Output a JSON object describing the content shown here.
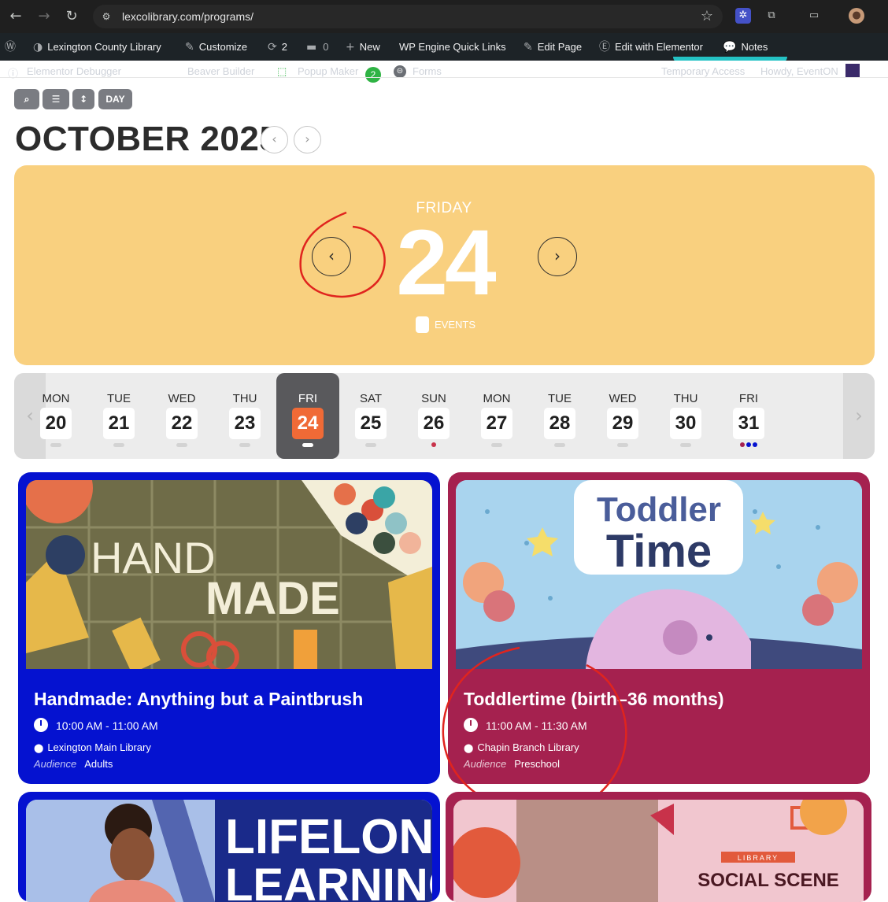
{
  "browser": {
    "url": "lexcolibrary.com/programs/",
    "back_icon": "←",
    "forward_icon": "→",
    "reload_icon": "↻",
    "star_icon": "☆"
  },
  "adminbar": {
    "site_name": "Lexington County Library",
    "customize": "Customize",
    "updates_count": "2",
    "comments_count": "0",
    "new": "New",
    "wp_engine": "WP Engine Quick Links",
    "edit_page": "Edit Page",
    "edit_elementor": "Edit with Elementor",
    "notes": "Notes"
  },
  "subbar": {
    "debugger": "Elementor Debugger",
    "beaver": "Beaver Builder",
    "popup": "Popup Maker",
    "popup_count": "2",
    "forms": "Forms",
    "temp_access": "Temporary Access",
    "howdy": "Howdy, EventON"
  },
  "controls": {
    "search_icon": "⌕",
    "filter_icon": "☰",
    "sort_icon": "↕",
    "day_label": "DAY"
  },
  "calendar": {
    "month_title": "OCTOBER 2025",
    "prev_icon": "‹",
    "next_icon": "›",
    "day_name": "FRIDAY",
    "day_number": "24",
    "events_label": "EVENTS",
    "accent_color": "#f9d07f",
    "active_color": "#f06a36"
  },
  "strip": {
    "days": [
      {
        "name": "MON",
        "num": "20"
      },
      {
        "name": "TUE",
        "num": "21"
      },
      {
        "name": "WED",
        "num": "22"
      },
      {
        "name": "THU",
        "num": "23"
      },
      {
        "name": "FRI",
        "num": "24"
      },
      {
        "name": "SAT",
        "num": "25"
      },
      {
        "name": "SUN",
        "num": "26"
      },
      {
        "name": "MON",
        "num": "27"
      },
      {
        "name": "TUE",
        "num": "28"
      },
      {
        "name": "WED",
        "num": "29"
      },
      {
        "name": "THU",
        "num": "30"
      },
      {
        "name": "FRI",
        "num": "31"
      }
    ],
    "active_index": 4
  },
  "events": [
    {
      "title": "Handmade: Anything but a Paintbrush",
      "time": "10:00 AM - 11:00 AM",
      "location": "Lexington Main Library",
      "audience_label": "Audience",
      "audience": "Adults",
      "color": "#0512d0",
      "image_text_1": "HAND",
      "image_text_2": "MADE"
    },
    {
      "title": "Toddlertime (birth–36 months)",
      "time": "11:00 AM - 11:30 AM",
      "location": "Chapin Branch Library",
      "audience_label": "Audience",
      "audience": "Preschool",
      "color": "#a5214f",
      "image_text_1": "Toddler",
      "image_text_2": "Time"
    },
    {
      "image_text_1": "LIFELONG",
      "image_text_2": "LEARNING",
      "color": "#0512d0"
    },
    {
      "image_text_1": "LIBRARY",
      "image_text_2": "SOCIAL SCENE",
      "color": "#a5214f"
    }
  ]
}
